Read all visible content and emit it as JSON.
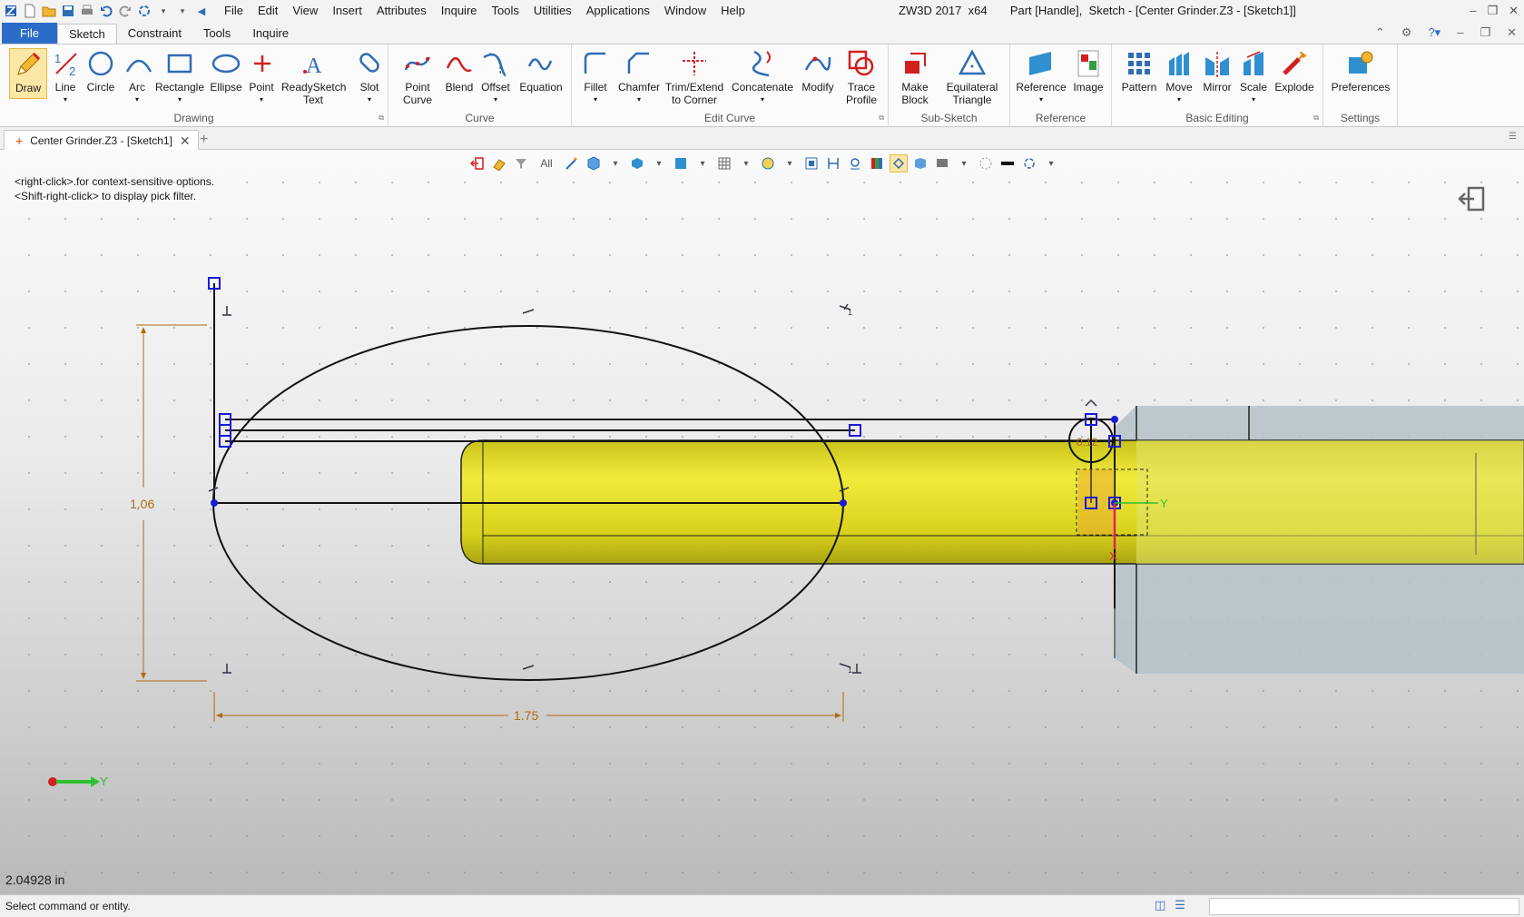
{
  "app": {
    "title": "ZW3D 2017  x64       Part [Handle],  Sketch - [Center Grinder.Z3 - [Sketch1]]",
    "menu": [
      "File",
      "Edit",
      "View",
      "Insert",
      "Attributes",
      "Inquire",
      "Tools",
      "Utilities",
      "Applications",
      "Window",
      "Help"
    ]
  },
  "ribbon_tabs": [
    "File",
    "Sketch",
    "Constraint",
    "Tools",
    "Inquire"
  ],
  "ribbon_groups": {
    "drawing": {
      "label": "Drawing",
      "buttons": [
        "Draw",
        "Line",
        "Circle",
        "Arc",
        "Rectangle",
        "Ellipse",
        "Point",
        "ReadySketch\nText",
        "Slot"
      ]
    },
    "curve": {
      "label": "Curve",
      "buttons": [
        "Point\nCurve",
        "Blend",
        "Offset",
        "Equation"
      ]
    },
    "edit_curve": {
      "label": "Edit Curve",
      "buttons": [
        "Fillet",
        "Chamfer",
        "Trim/Extend\nto Corner",
        "Concatenate",
        "Modify",
        "Trace\nProfile"
      ]
    },
    "sub_sketch": {
      "label": "Sub-Sketch",
      "buttons": [
        "Make\nBlock",
        "Equilateral\nTriangle"
      ]
    },
    "reference": {
      "label": "Reference",
      "buttons": [
        "Reference",
        "Image"
      ]
    },
    "basic_editing": {
      "label": "Basic Editing",
      "buttons": [
        "Pattern",
        "Move",
        "Mirror",
        "Scale",
        "Explode"
      ]
    },
    "settings": {
      "label": "Settings",
      "buttons": [
        "Preferences"
      ]
    }
  },
  "document_tab": "Center Grinder.Z3 - [Sketch1]",
  "view_toolbar": {
    "filter": "All"
  },
  "viewport": {
    "hints": [
      "<right-click>.for context-sensitive options.",
      "<Shift-right-click> to display pick filter."
    ],
    "dim_vertical": "1.06",
    "dim_horizontal": "1.75",
    "small_dim": "0.12",
    "axis_x": "X",
    "axis_y": "Y",
    "triad_y": "Y",
    "coord_readout": "2.04928 in"
  },
  "status": {
    "message": "Select command or entity."
  },
  "colors": {
    "accent": "#2b6cc8",
    "sketch_line": "#111111",
    "dimension": "#b06a10",
    "constraint_box": "#1a1ad6",
    "part_yellow": "#d8d21c",
    "part_steel": "#b4c2c8"
  }
}
